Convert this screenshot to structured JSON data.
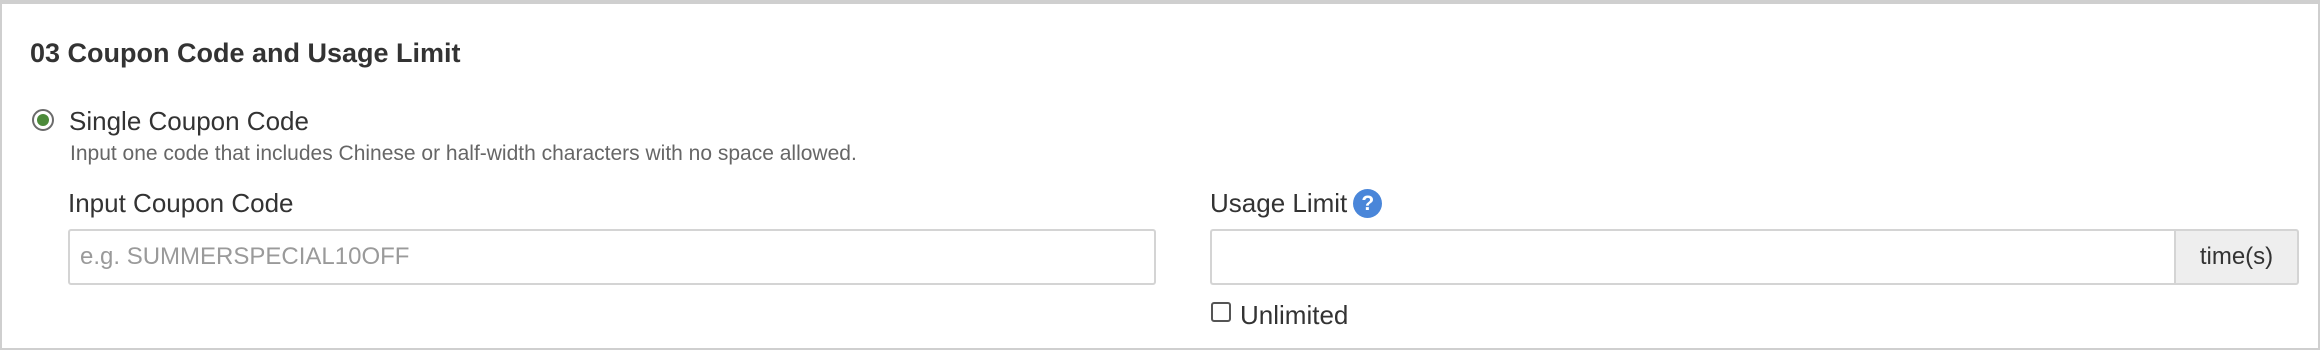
{
  "section": {
    "title": "03 Coupon Code and Usage Limit"
  },
  "coupon_type": {
    "option_label": "Single Coupon Code",
    "selected": true,
    "help_text": "Input one code that includes Chinese or half-width characters with no space allowed.",
    "accent_color": "#4c8a3a"
  },
  "coupon_code": {
    "label": "Input Coupon Code",
    "value": "",
    "placeholder": "e.g. SUMMERSPECIAL10OFF"
  },
  "usage_limit": {
    "label": "Usage Limit",
    "help_icon": "question-circle-icon",
    "help_glyph": "?",
    "value": "",
    "unit": "time(s)",
    "unlimited_label": "Unlimited",
    "unlimited_checked": false,
    "help_icon_color": "#4a86d9"
  }
}
